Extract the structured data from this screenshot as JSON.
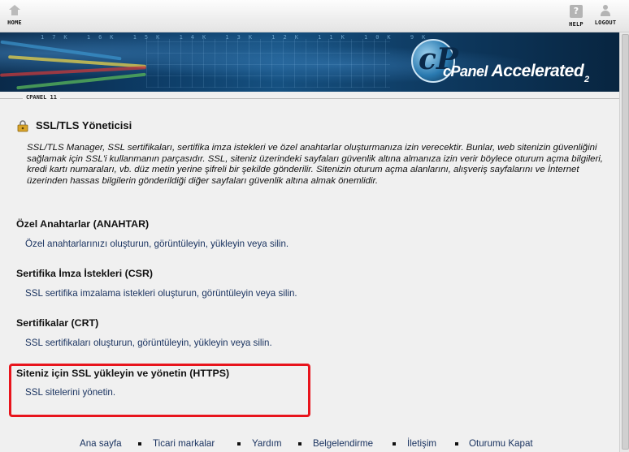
{
  "topbar": {
    "home_label": "HOME",
    "help_label": "HELP",
    "logout_label": "LOGOUT"
  },
  "banner": {
    "ticker_text": "17K 16K 15K 14K 13K 12K 11K 10K 9K",
    "logo_c": "cP",
    "logo_brand": "cPanel",
    "logo_accelerated": "Accelerated",
    "logo_version": "2"
  },
  "version_bar": {
    "label": "CPANEL 11"
  },
  "page": {
    "title": "SSL/TLS Yöneticisi",
    "description": "SSL/TLS Manager, SSL sertifikaları, sertifika imza istekleri ve özel anahtarlar oluşturmanıza izin verecektir. Bunlar, web sitenizin güvenliğini sağlamak için SSL'i kullanmanın parçasıdır. SSL, siteniz üzerindeki sayfaları güvenlik altına almanıza izin verir böylece oturum açma bilgileri, kredi kartı numaraları, vb. düz metin yerine şifreli bir şekilde gönderilir. Sitenizin oturum açma alanlarını, alışveriş sayfalarını ve İnternet üzerinden hassas bilgilerin gönderildiği diğer sayfaları güvenlik altına almak önemlidir.",
    "sections": [
      {
        "title": "Özel Anahtarlar (ANAHTAR)",
        "link": "Özel anahtarlarınızı oluşturun, görüntüleyin, yükleyin veya silin."
      },
      {
        "title": "Sertifika İmza İstekleri (CSR)",
        "link": "SSL sertifika imzalama istekleri oluşturun, görüntüleyin veya silin."
      },
      {
        "title": "Sertifikalar (CRT)",
        "link": "SSL sertifikaları oluşturun, görüntüleyin, yükleyin veya silin."
      },
      {
        "title": "Siteniz için SSL yükleyin ve yönetin (HTTPS)",
        "link": "SSL sitelerini yönetin."
      }
    ]
  },
  "footer": {
    "links": [
      "Ana sayfa",
      "Ticari markalar",
      "Yardım",
      "Belgelendirme",
      "İletişim",
      "Oturumu Kapat"
    ]
  },
  "colors": {
    "highlight_border": "#e8141c",
    "link": "#1a3360",
    "banner_bg": "#0d3c66"
  }
}
